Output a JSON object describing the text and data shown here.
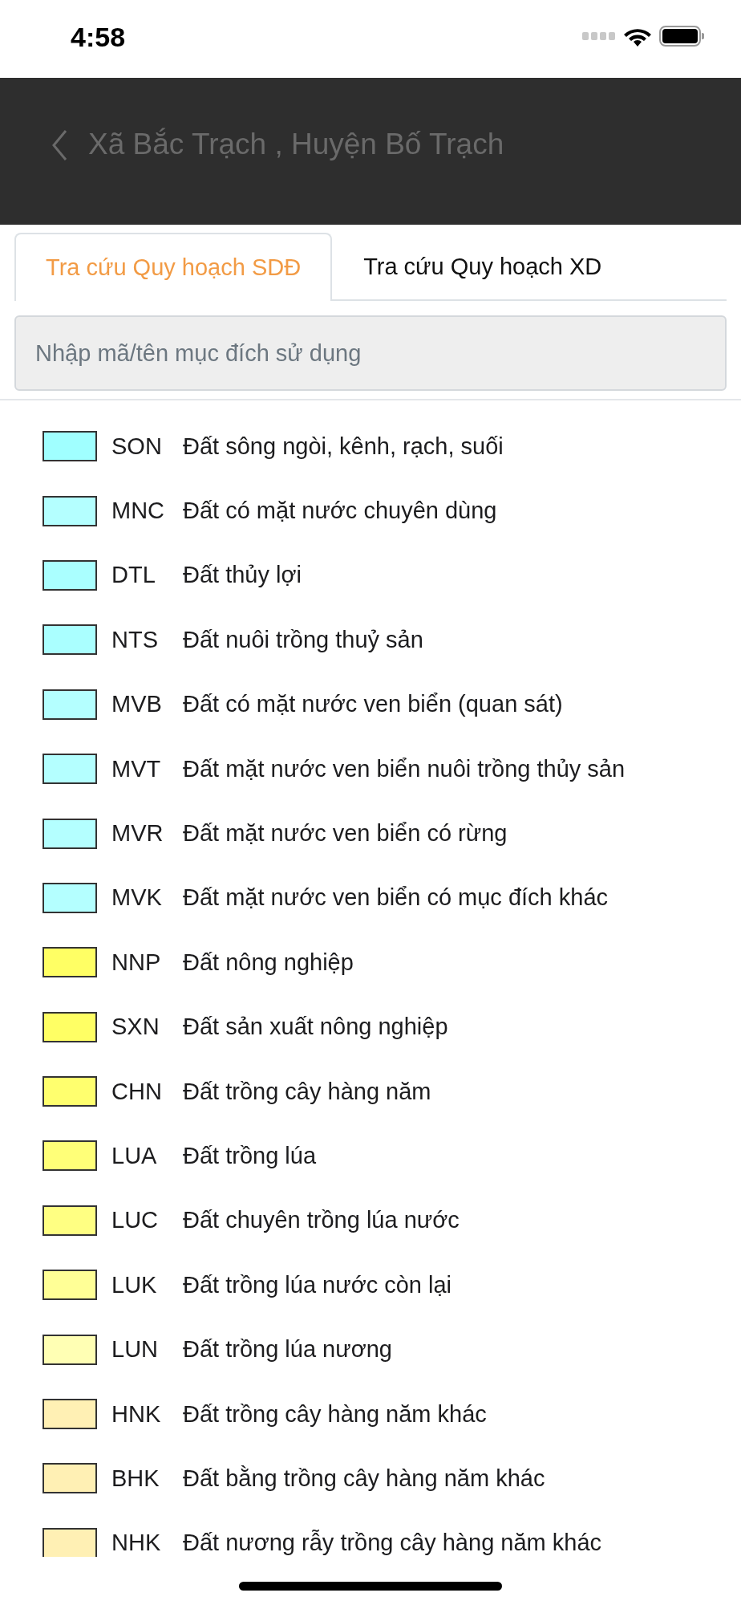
{
  "status_bar": {
    "time": "4:58"
  },
  "header": {
    "title": "Xã Bắc Trạch , Huyện Bố Trạch"
  },
  "tabs": [
    {
      "label": "Tra cứu Quy hoạch SDĐ",
      "selected": true
    },
    {
      "label": "Tra cứu Quy hoạch XD",
      "selected": false
    }
  ],
  "search": {
    "placeholder": "Nhập mã/tên mục đích sử dụng"
  },
  "legend": [
    {
      "code": "SON",
      "name": "Đất sông ngòi, kênh, rạch, suối",
      "color": "#a0ffff"
    },
    {
      "code": "MNC",
      "name": "Đất có mặt nước chuyên dùng",
      "color": "#b4ffff"
    },
    {
      "code": "DTL",
      "name": "Đất thủy lợi",
      "color": "#aaffff"
    },
    {
      "code": "NTS",
      "name": "Đất nuôi trồng thuỷ sản",
      "color": "#aaffff"
    },
    {
      "code": "MVB",
      "name": "Đất có mặt nước ven biển (quan sát)",
      "color": "#b4ffff"
    },
    {
      "code": "MVT",
      "name": "Đất mặt nước ven biển nuôi trồng thủy sản",
      "color": "#b4ffff"
    },
    {
      "code": "MVR",
      "name": "Đất mặt nước ven biển có rừng",
      "color": "#b4ffff"
    },
    {
      "code": "MVK",
      "name": "Đất mặt nước ven biển có mục đích khác",
      "color": "#b4ffff"
    },
    {
      "code": "NNP",
      "name": "Đất nông nghiệp",
      "color": "#ffff64"
    },
    {
      "code": "SXN",
      "name": "Đất sản xuất nông nghiệp",
      "color": "#ffff64"
    },
    {
      "code": "CHN",
      "name": "Đất trồng cây hàng năm",
      "color": "#ffff6e"
    },
    {
      "code": "LUA",
      "name": "Đất trồng lúa",
      "color": "#ffff78"
    },
    {
      "code": "LUC",
      "name": "Đất chuyên trồng lúa nước",
      "color": "#ffff82"
    },
    {
      "code": "LUK",
      "name": "Đất trồng lúa nước còn lại",
      "color": "#ffff96"
    },
    {
      "code": "LUN",
      "name": "Đất trồng lúa nương",
      "color": "#ffffb4"
    },
    {
      "code": "HNK",
      "name": "Đất trồng cây hàng năm khác",
      "color": "#fff0b4"
    },
    {
      "code": "BHK",
      "name": "Đất bằng trồng cây hàng năm khác",
      "color": "#fff0b4"
    },
    {
      "code": "NHK",
      "name": "Đất nương rẫy trồng cây hàng năm khác",
      "color": "#fff0b4"
    }
  ]
}
